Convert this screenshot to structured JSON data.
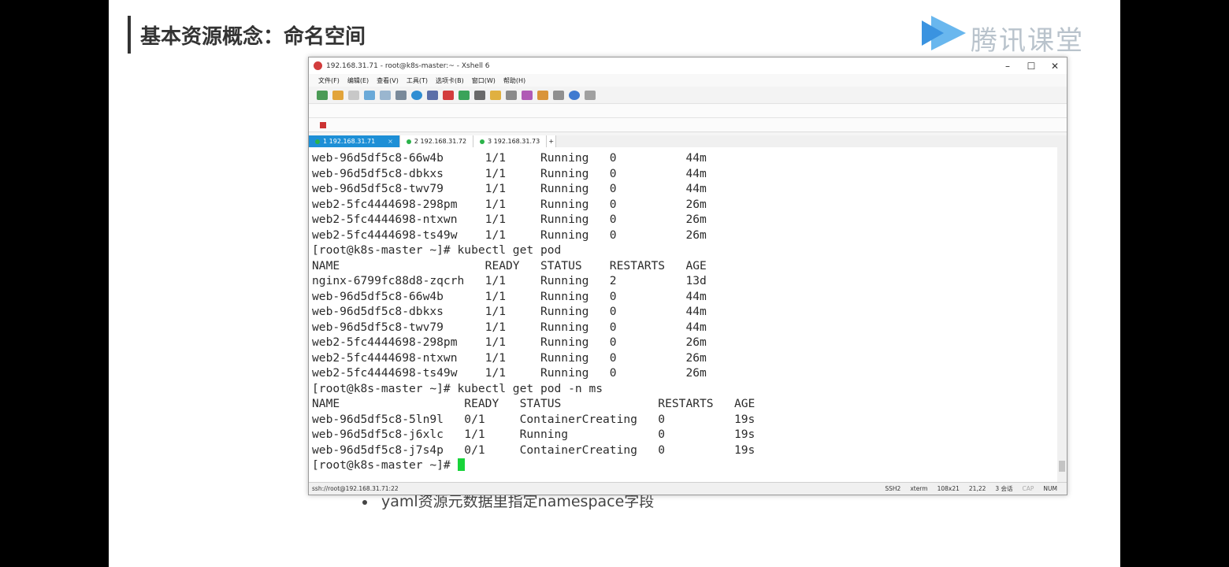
{
  "slide": {
    "title": "基本资源概念：命名空间",
    "brand_text": "腾讯课堂",
    "bullet": "yaml资源元数据里指定namespace字段"
  },
  "window": {
    "title": "192.168.31.71 - root@k8s-master:~ - Xshell 6",
    "controls": [
      "–",
      "☐",
      "✕"
    ]
  },
  "menubar": {
    "items": [
      "文件(F)",
      "编辑(E)",
      "查看(V)",
      "工具(T)",
      "选项卡(B)",
      "窗口(W)",
      "帮助(H)"
    ]
  },
  "tabs": [
    {
      "label": "1 192.168.31.71",
      "close": "×"
    },
    {
      "label": "2 192.168.31.72"
    },
    {
      "label": "3 192.168.31.73"
    },
    {
      "label": "+"
    }
  ],
  "terminal": {
    "lines": [
      "web-96d5df5c8-66w4b      1/1     Running   0          44m",
      "web-96d5df5c8-dbkxs      1/1     Running   0          44m",
      "web-96d5df5c8-twv79      1/1     Running   0          44m",
      "web2-5fc4444698-298pm    1/1     Running   0          26m",
      "web2-5fc4444698-ntxwn    1/1     Running   0          26m",
      "web2-5fc4444698-ts49w    1/1     Running   0          26m",
      "[root@k8s-master ~]# kubectl get pod",
      "NAME                     READY   STATUS    RESTARTS   AGE",
      "nginx-6799fc88d8-zqcrh   1/1     Running   2          13d",
      "web-96d5df5c8-66w4b      1/1     Running   0          44m",
      "web-96d5df5c8-dbkxs      1/1     Running   0          44m",
      "web-96d5df5c8-twv79      1/1     Running   0          44m",
      "web2-5fc4444698-298pm    1/1     Running   0          26m",
      "web2-5fc4444698-ntxwn    1/1     Running   0          26m",
      "web2-5fc4444698-ts49w    1/1     Running   0          26m",
      "[root@k8s-master ~]# kubectl get pod -n ms",
      "NAME                  READY   STATUS              RESTARTS   AGE",
      "web-96d5df5c8-5ln9l   0/1     ContainerCreating   0          19s",
      "web-96d5df5c8-j6xlc   1/1     Running             0          19s",
      "web-96d5df5c8-j7s4p   0/1     ContainerCreating   0          19s"
    ],
    "prompt": "[root@k8s-master ~]# ",
    "cursor_color": "#18d43a"
  },
  "statusbar": {
    "connection": "ssh://root@192.168.31.71:22",
    "items": [
      "SSH2",
      "xterm",
      "108x21",
      "21,22",
      "3 会话",
      "CAP",
      "NUM"
    ]
  }
}
